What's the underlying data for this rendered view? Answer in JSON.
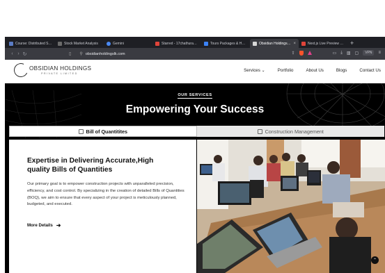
{
  "browser": {
    "tabs": [
      {
        "title": "Course: Distributed Syst",
        "color": "#5b7cc4",
        "active": false
      },
      {
        "title": "Stock Market Analysis",
        "color": "#6b6b6b",
        "active": false
      },
      {
        "title": "Gemini",
        "color": "#4a8af4",
        "active": false
      },
      {
        "title": "Starred - 17chathuranjan",
        "color": "#e0443a",
        "active": false
      },
      {
        "title": "Tours Packages & Holida",
        "color": "#3b82f6",
        "active": false
      },
      {
        "title": "Obsidian Holdings - S",
        "color": "#d8d8d8",
        "active": true
      },
      {
        "title": "Next.js Live Preview - Lo",
        "color": "#e0443a",
        "active": false
      }
    ],
    "new_tab": "+",
    "url": "obsidianholdingslk.com",
    "vpn": "VPN"
  },
  "site": {
    "logo_name": "OBSIDIAN HOLDINGS",
    "logo_sub": "PRIVATE LIMITED",
    "menu": [
      "Services",
      "Portfolio",
      "About Us",
      "Blogs",
      "Contact Us"
    ],
    "services_caret": "⌄"
  },
  "hero": {
    "section_label": "OUR SERVICES",
    "title": "Empowering Your Success",
    "tabs": [
      {
        "label": "Bill of Quantitites",
        "active": true
      },
      {
        "label": "Construction Management",
        "active": false
      }
    ]
  },
  "card": {
    "title": "Expertise in Delivering Accurate,High quality Bills of Quantities",
    "text": "Our primary goal is to empower construction projects with unparalleled precision, efficiency, and cost control. By specializing in the creation of detailed Bills of Quantities (BOQ), we aim to ensure that every aspect of your project is meticulously planned, budgeted, and executed.",
    "more": "More Details",
    "arrow": "➜"
  },
  "scroll_top": "⌃"
}
